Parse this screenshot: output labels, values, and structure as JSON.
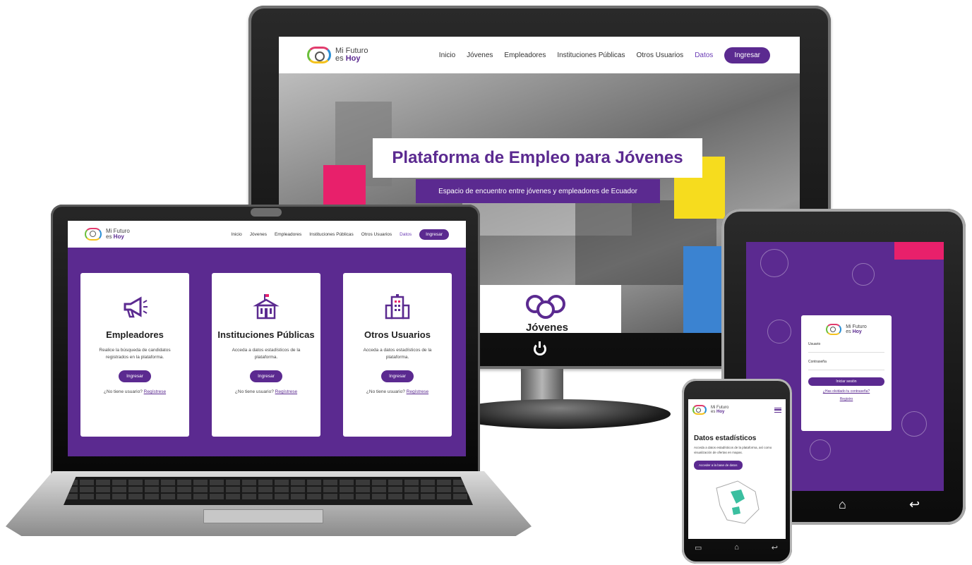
{
  "brand": {
    "line1": "Mi Futuro",
    "line2_prefix": "es ",
    "line2_bold": "Hoy"
  },
  "nav": {
    "links": [
      "Inicio",
      "Jóvenes",
      "Empleadores",
      "Instituciones Públicas",
      "Otros Usuarios"
    ],
    "datos": "Datos",
    "ingresar": "Ingresar"
  },
  "hero": {
    "title": "Plataforma de Empleo para Jóvenes",
    "subtitle": "Espacio de encuentro entre jóvenes y empleadores de Ecuador",
    "section_label": "Jóvenes"
  },
  "cards": [
    {
      "title": "Empleadores",
      "desc": "Realice la búsqueda de candidatos registrados en la plataforma.",
      "button": "Ingresar",
      "reg_text": "¿No tiene usuario?",
      "reg_link": "Regístrese"
    },
    {
      "title": "Instituciones Públicas",
      "desc": "Acceda a datos estadísticos de la plataforma.",
      "button": "Ingresar",
      "reg_text": "¿No tiene usuario?",
      "reg_link": "Regístrese"
    },
    {
      "title": "Otros Usuarios",
      "desc": "Acceda a datos estadísticos de la plataforma.",
      "button": "Ingresar",
      "reg_text": "¿No tiene usuario?",
      "reg_link": "Regístrese"
    }
  ],
  "login": {
    "user_label": "Usuario",
    "pass_label": "Contraseña",
    "button": "Iniciar sesión",
    "forgot": "¿Has olvidado tu contraseña?",
    "register": "Registro"
  },
  "phone": {
    "title": "Datos estadísticos",
    "desc": "Acceda a datos estadísticos de la plataforma, así como visualización de ofertas en mapas.",
    "button": "Acceder a la base de datos"
  },
  "colors": {
    "purple": "#5b2a90",
    "pink": "#e8206b",
    "yellow": "#f6dc1e",
    "blue": "#3b83d1"
  },
  "icons": {
    "power": "power-icon",
    "home": "home-icon",
    "back": "back-icon",
    "menu": "hamburger-menu-icon"
  }
}
